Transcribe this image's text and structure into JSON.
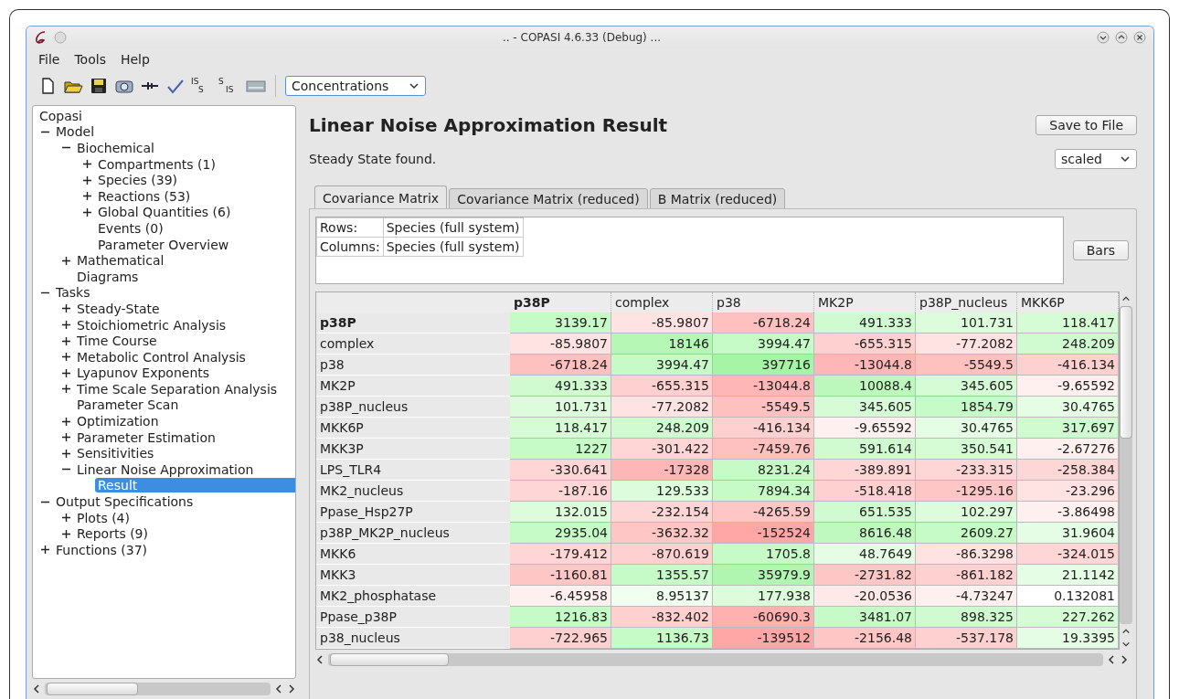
{
  "window": {
    "title": ".. - COPASI 4.6.33 (Debug) ..."
  },
  "menu": [
    "File",
    "Tools",
    "Help"
  ],
  "toolbar": [
    {
      "kind": "new"
    },
    {
      "kind": "open"
    },
    {
      "kind": "save"
    },
    {
      "kind": "camera"
    },
    {
      "kind": "reaction"
    },
    {
      "kind": "check"
    },
    {
      "kind": "convert",
      "top": "IS",
      "bottom": "S"
    },
    {
      "kind": "convert",
      "top": "S",
      "bottom": "IS"
    },
    {
      "kind": "image"
    }
  ],
  "unit_select": {
    "value": "Concentrations"
  },
  "tree": {
    "label": "Copasi",
    "selected": false,
    "children": [
      {
        "label": "Model",
        "expanded": true,
        "selected": false,
        "children": [
          {
            "label": "Biochemical",
            "expanded": true,
            "selected": false,
            "children": [
              {
                "label": "Compartments (1)",
                "expanded": false,
                "selected": false
              },
              {
                "label": "Species (39)",
                "expanded": false,
                "selected": false
              },
              {
                "label": "Reactions (53)",
                "expanded": false,
                "selected": false
              },
              {
                "label": "Global Quantities (6)",
                "expanded": false,
                "selected": false
              },
              {
                "label": "Events (0)",
                "selected": false
              },
              {
                "label": "Parameter Overview",
                "selected": false
              }
            ]
          },
          {
            "label": "Mathematical",
            "expanded": false,
            "selected": false
          },
          {
            "label": "Diagrams",
            "selected": false
          }
        ]
      },
      {
        "label": "Tasks",
        "expanded": true,
        "selected": false,
        "children": [
          {
            "label": "Steady-State",
            "expanded": false,
            "selected": false
          },
          {
            "label": "Stoichiometric Analysis",
            "expanded": false,
            "selected": false
          },
          {
            "label": "Time Course",
            "expanded": false,
            "selected": false
          },
          {
            "label": "Metabolic Control Analysis",
            "expanded": false,
            "selected": false
          },
          {
            "label": "Lyapunov Exponents",
            "expanded": false,
            "selected": false
          },
          {
            "label": "Time Scale Separation Analysis",
            "expanded": false,
            "selected": false
          },
          {
            "label": "Parameter Scan",
            "selected": false
          },
          {
            "label": "Optimization",
            "expanded": false,
            "selected": false
          },
          {
            "label": "Parameter Estimation",
            "expanded": false,
            "selected": false
          },
          {
            "label": "Sensitivities",
            "expanded": false,
            "selected": false
          },
          {
            "label": "Linear Noise Approximation",
            "expanded": true,
            "selected": false,
            "children": [
              {
                "label": "Result",
                "selected": true
              }
            ]
          }
        ]
      },
      {
        "label": "Output Specifications",
        "expanded": true,
        "selected": false,
        "children": [
          {
            "label": "Plots (4)",
            "expanded": false,
            "selected": false
          },
          {
            "label": "Reports (9)",
            "expanded": false,
            "selected": false
          }
        ]
      },
      {
        "label": "Functions (37)",
        "expanded": false,
        "selected": false
      }
    ]
  },
  "result": {
    "title": "Linear Noise Approximation Result",
    "status": "Steady State found.",
    "save_button": "Save to File",
    "scale_select": {
      "value": "scaled"
    },
    "tabs": [
      {
        "label": "Covariance Matrix",
        "selected": true
      },
      {
        "label": "Covariance Matrix (reduced)",
        "selected": false
      },
      {
        "label": "B Matrix (reduced)",
        "selected": false
      }
    ],
    "info": [
      {
        "key": "Rows:",
        "value": "Species (full system)"
      },
      {
        "key": "Columns:",
        "value": "Species (full system)"
      }
    ],
    "bars_button": "Bars",
    "columns": [
      {
        "label": "p38P",
        "selected": true
      },
      {
        "label": "complex",
        "selected": false
      },
      {
        "label": "p38",
        "selected": false
      },
      {
        "label": "MK2P",
        "selected": false
      },
      {
        "label": "p38P_nucleus",
        "selected": false
      },
      {
        "label": "MKK6P",
        "selected": false
      }
    ],
    "rows": [
      {
        "label": "p38P",
        "selected": true,
        "cells": [
          {
            "value": "3139.17",
            "color": "#c6fac6"
          },
          {
            "value": "-85.9807",
            "color": "#ffe2e2"
          },
          {
            "value": "-6718.24",
            "color": "#ffc0c0"
          },
          {
            "value": "491.333",
            "color": "#d0fbd0"
          },
          {
            "value": "101.731",
            "color": "#dcfcdc"
          },
          {
            "value": "118.417",
            "color": "#d6fcd6"
          }
        ]
      },
      {
        "label": "complex",
        "selected": false,
        "cells": [
          {
            "value": "-85.9807",
            "color": "#ffe2e2"
          },
          {
            "value": "18146",
            "color": "#b6f7b6"
          },
          {
            "value": "3994.47",
            "color": "#c6fac6"
          },
          {
            "value": "-655.315",
            "color": "#ffd0d0"
          },
          {
            "value": "-77.2082",
            "color": "#ffe2e2"
          },
          {
            "value": "248.209",
            "color": "#d0fbd0"
          }
        ]
      },
      {
        "label": "p38",
        "selected": false,
        "cells": [
          {
            "value": "-6718.24",
            "color": "#ffc0c0"
          },
          {
            "value": "3994.47",
            "color": "#c6fac6"
          },
          {
            "value": "397716",
            "color": "#a6f4a6"
          },
          {
            "value": "-13044.8",
            "color": "#ffb6b6"
          },
          {
            "value": "-5549.5",
            "color": "#ffc0c0"
          },
          {
            "value": "-416.134",
            "color": "#ffd0d0"
          }
        ]
      },
      {
        "label": "MK2P",
        "selected": false,
        "cells": [
          {
            "value": "491.333",
            "color": "#d0fbd0"
          },
          {
            "value": "-655.315",
            "color": "#ffd0d0"
          },
          {
            "value": "-13044.8",
            "color": "#ffb6b6"
          },
          {
            "value": "10088.4",
            "color": "#bcf8bc"
          },
          {
            "value": "345.605",
            "color": "#d6fcd6"
          },
          {
            "value": "-9.65592",
            "color": "#fff0f0"
          }
        ]
      },
      {
        "label": "p38P_nucleus",
        "selected": false,
        "cells": [
          {
            "value": "101.731",
            "color": "#dcfcdc"
          },
          {
            "value": "-77.2082",
            "color": "#ffe2e2"
          },
          {
            "value": "-5549.5",
            "color": "#ffc0c0"
          },
          {
            "value": "345.605",
            "color": "#d6fcd6"
          },
          {
            "value": "1854.79",
            "color": "#c6fac6"
          },
          {
            "value": "30.4765",
            "color": "#e4fde4"
          }
        ]
      },
      {
        "label": "MKK6P",
        "selected": false,
        "cells": [
          {
            "value": "118.417",
            "color": "#d6fcd6"
          },
          {
            "value": "248.209",
            "color": "#d0fbd0"
          },
          {
            "value": "-416.134",
            "color": "#ffd0d0"
          },
          {
            "value": "-9.65592",
            "color": "#fff0f0"
          },
          {
            "value": "30.4765",
            "color": "#e4fde4"
          },
          {
            "value": "317.697",
            "color": "#d0fbd0"
          }
        ]
      },
      {
        "label": "MKK3P",
        "selected": false,
        "cells": [
          {
            "value": "1227",
            "color": "#c6fac6"
          },
          {
            "value": "-301.422",
            "color": "#ffd6d6"
          },
          {
            "value": "-7459.76",
            "color": "#ffc0c0"
          },
          {
            "value": "591.614",
            "color": "#d0fbd0"
          },
          {
            "value": "350.541",
            "color": "#d6fcd6"
          },
          {
            "value": "-2.67276",
            "color": "#fff0f0"
          }
        ]
      },
      {
        "label": "LPS_TLR4",
        "selected": false,
        "cells": [
          {
            "value": "-330.641",
            "color": "#ffd6d6"
          },
          {
            "value": "-17328",
            "color": "#ffb6b6"
          },
          {
            "value": "8231.24",
            "color": "#c6fac6"
          },
          {
            "value": "-389.891",
            "color": "#ffd6d6"
          },
          {
            "value": "-233.315",
            "color": "#ffd6d6"
          },
          {
            "value": "-258.384",
            "color": "#ffd6d6"
          }
        ]
      },
      {
        "label": "MK2_nucleus",
        "selected": false,
        "cells": [
          {
            "value": "-187.16",
            "color": "#ffd6d6"
          },
          {
            "value": "129.533",
            "color": "#dcfcdc"
          },
          {
            "value": "7894.34",
            "color": "#c6fac6"
          },
          {
            "value": "-518.418",
            "color": "#ffd0d0"
          },
          {
            "value": "-1295.16",
            "color": "#ffc6c6"
          },
          {
            "value": "-23.296",
            "color": "#ffe2e2"
          }
        ]
      },
      {
        "label": "Ppase_Hsp27P",
        "selected": false,
        "cells": [
          {
            "value": "132.015",
            "color": "#dcfcdc"
          },
          {
            "value": "-232.154",
            "color": "#ffd6d6"
          },
          {
            "value": "-4265.59",
            "color": "#ffc6c6"
          },
          {
            "value": "651.535",
            "color": "#d0fbd0"
          },
          {
            "value": "102.297",
            "color": "#dcfcdc"
          },
          {
            "value": "-3.86498",
            "color": "#fff0f0"
          }
        ]
      },
      {
        "label": "p38P_MK2P_nucleus",
        "selected": false,
        "cells": [
          {
            "value": "2935.04",
            "color": "#c6fac6"
          },
          {
            "value": "-3632.32",
            "color": "#ffc6c6"
          },
          {
            "value": "-152524",
            "color": "#ffa6a6"
          },
          {
            "value": "8616.48",
            "color": "#c0f9c0"
          },
          {
            "value": "2609.27",
            "color": "#c6fac6"
          },
          {
            "value": "31.9604",
            "color": "#e4fde4"
          }
        ]
      },
      {
        "label": "MKK6",
        "selected": false,
        "cells": [
          {
            "value": "-179.412",
            "color": "#ffd6d6"
          },
          {
            "value": "-870.619",
            "color": "#ffd0d0"
          },
          {
            "value": "1705.8",
            "color": "#c6fac6"
          },
          {
            "value": "48.7649",
            "color": "#e4fde4"
          },
          {
            "value": "-86.3298",
            "color": "#ffe2e2"
          },
          {
            "value": "-324.015",
            "color": "#ffd6d6"
          }
        ]
      },
      {
        "label": "MKK3",
        "selected": false,
        "cells": [
          {
            "value": "-1160.81",
            "color": "#ffc6c6"
          },
          {
            "value": "1355.57",
            "color": "#c6fac6"
          },
          {
            "value": "35979.9",
            "color": "#b0f6b0"
          },
          {
            "value": "-2731.82",
            "color": "#ffc6c6"
          },
          {
            "value": "-861.182",
            "color": "#ffd0d0"
          },
          {
            "value": "21.1142",
            "color": "#e4fde4"
          }
        ]
      },
      {
        "label": "MK2_phosphatase",
        "selected": false,
        "cells": [
          {
            "value": "-6.45958",
            "color": "#fff0f0"
          },
          {
            "value": "8.95137",
            "color": "#f0fff0"
          },
          {
            "value": "177.938",
            "color": "#dcfcdc"
          },
          {
            "value": "-20.0536",
            "color": "#ffe8e8"
          },
          {
            "value": "-4.73247",
            "color": "#fff0f0"
          },
          {
            "value": "0.132081",
            "color": "#ffffff"
          }
        ]
      },
      {
        "label": "Ppase_p38P",
        "selected": false,
        "cells": [
          {
            "value": "1216.83",
            "color": "#c6fac6"
          },
          {
            "value": "-832.402",
            "color": "#ffd0d0"
          },
          {
            "value": "-60690.3",
            "color": "#ffb0b0"
          },
          {
            "value": "3481.07",
            "color": "#c6fac6"
          },
          {
            "value": "898.325",
            "color": "#d0fbd0"
          },
          {
            "value": "227.262",
            "color": "#d6fcd6"
          }
        ]
      },
      {
        "label": "p38_nucleus",
        "selected": false,
        "cells": [
          {
            "value": "-722.965",
            "color": "#ffd0d0"
          },
          {
            "value": "1136.73",
            "color": "#c6fac6"
          },
          {
            "value": "-139512",
            "color": "#ffa6a6"
          },
          {
            "value": "-2156.48",
            "color": "#ffc6c6"
          },
          {
            "value": "-537.178",
            "color": "#ffd0d0"
          },
          {
            "value": "19.3395",
            "color": "#e4fde4"
          }
        ]
      }
    ]
  }
}
